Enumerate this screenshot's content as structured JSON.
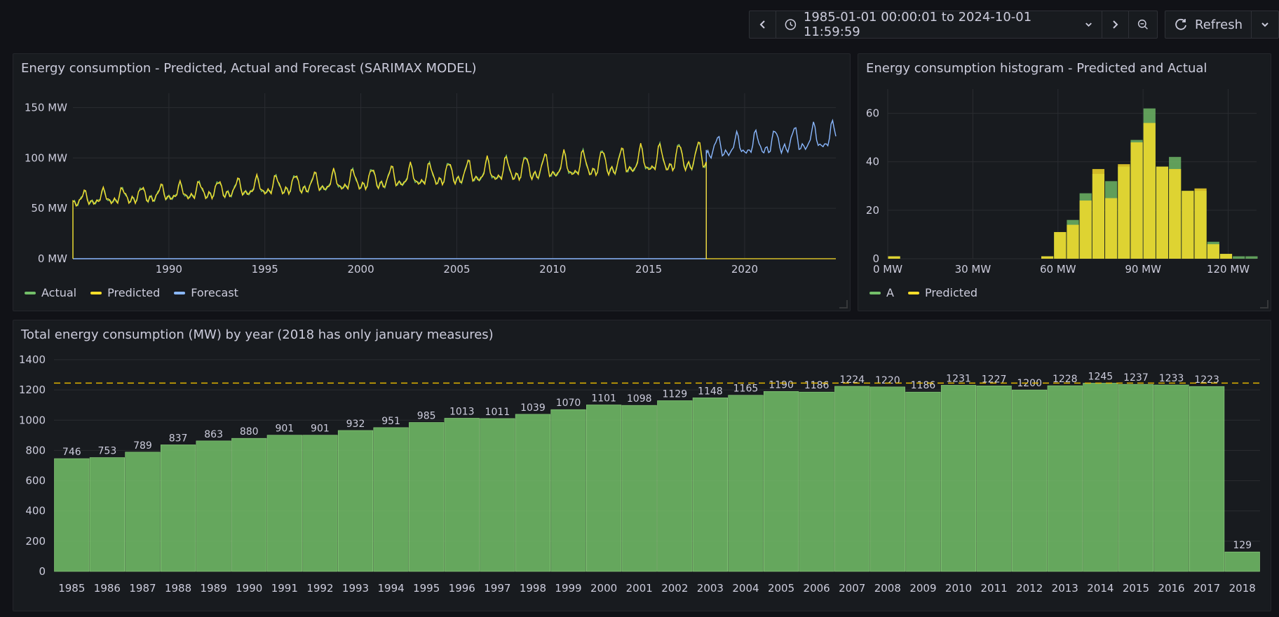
{
  "toolbar": {
    "time_range": "1985-01-01 00:00:01 to 2024-10-01 11:59:59",
    "refresh_label": "Refresh",
    "icons": [
      "chevron-left-icon",
      "clock-icon",
      "chevron-down-icon",
      "chevron-right-icon",
      "zoom-out-icon",
      "refresh-icon",
      "chevron-down-icon"
    ]
  },
  "colors": {
    "actual": "#73bf69",
    "predicted": "#fade2a",
    "forecast": "#8ab8ff",
    "threshold": "#e0b400"
  },
  "line_panel": {
    "title": "Energy consumption - Predicted, Actual and Forecast (SARIMAX MODEL)"
  },
  "hist_panel": {
    "title": "Energy consumption histogram - Predicted and Actual"
  },
  "bar_panel": {
    "title": "Total energy consumption (MW) by year (2018 has only january measures)"
  },
  "chart_data": [
    {
      "type": "line",
      "title": "Energy consumption - Predicted, Actual and Forecast (SARIMAX MODEL)",
      "x_ticks": [
        "1990",
        "1995",
        "2000",
        "2005",
        "2010",
        "2015",
        "2020"
      ],
      "y_ticks": [
        "0 MW",
        "50 MW",
        "100 MW",
        "150 MW"
      ],
      "xlim": [
        1985.0,
        2024.75
      ],
      "ylim": [
        0,
        160
      ],
      "legend": "bottom-left",
      "series": [
        {
          "name": "Actual",
          "start": 1985.0,
          "end": 2018.0,
          "base_start": 58,
          "base_end": 100,
          "amplitude_start": 8,
          "amplitude_end": 17
        },
        {
          "name": "Predicted",
          "start": 1985.0,
          "end": 2018.0,
          "base_start": 58,
          "base_end": 100,
          "amplitude_start": 8,
          "amplitude_end": 17
        },
        {
          "name": "Forecast",
          "start": 2018.0,
          "end": 2024.75,
          "base_start": 108,
          "base_end": 120,
          "amplitude_start": 12,
          "amplitude_end": 16
        }
      ]
    },
    {
      "type": "bar",
      "title": "Energy consumption histogram - Predicted and Actual",
      "x_ticks": [
        "0 MW",
        "30 MW",
        "60 MW",
        "90 MW",
        "120 MW"
      ],
      "y_ticks": [
        "0",
        "20",
        "40",
        "60"
      ],
      "xlim": [
        0,
        130
      ],
      "ylim": [
        0,
        70
      ],
      "bin_width": 4.5,
      "legend": "bottom-left",
      "series": [
        {
          "name": "A",
          "bins": [
            0,
            4.5,
            49.5,
            54,
            58.5,
            63,
            67.5,
            72,
            76.5,
            81,
            85.5,
            90,
            94.5,
            99,
            103.5,
            108,
            112.5,
            117,
            121.5,
            126
          ],
          "values": [
            1,
            0,
            0,
            1,
            11,
            16,
            27,
            35,
            32,
            38,
            49,
            62,
            38,
            42,
            28,
            28,
            7,
            2,
            1,
            1
          ]
        },
        {
          "name": "Predicted",
          "bins": [
            0,
            4.5,
            49.5,
            54,
            58.5,
            63,
            67.5,
            72,
            76.5,
            81,
            85.5,
            90,
            94.5,
            99,
            103.5,
            108,
            112.5,
            117,
            121.5,
            126
          ],
          "values": [
            1,
            0,
            0,
            1,
            11,
            14,
            24,
            37,
            25,
            39,
            48,
            56,
            38,
            37,
            28,
            29,
            6,
            2,
            0,
            0
          ]
        }
      ]
    },
    {
      "type": "bar",
      "title": "Total energy consumption (MW) by year (2018 has only january measures)",
      "categories": [
        "1985",
        "1986",
        "1987",
        "1988",
        "1989",
        "1990",
        "1991",
        "1992",
        "1993",
        "1994",
        "1995",
        "1996",
        "1997",
        "1998",
        "1999",
        "2000",
        "2001",
        "2002",
        "2003",
        "2004",
        "2005",
        "2006",
        "2007",
        "2008",
        "2009",
        "2010",
        "2011",
        "2012",
        "2013",
        "2014",
        "2015",
        "2016",
        "2017",
        "2018"
      ],
      "values": [
        746,
        753,
        789,
        837,
        863,
        880,
        901,
        901,
        932,
        951,
        985,
        1013,
        1011,
        1039,
        1070,
        1101,
        1098,
        1129,
        1148,
        1165,
        1190,
        1186,
        1224,
        1220,
        1186,
        1231,
        1227,
        1200,
        1228,
        1245,
        1237,
        1233,
        1223,
        129
      ],
      "y_ticks": [
        "0",
        "200",
        "400",
        "600",
        "800",
        "1000",
        "1200",
        "1400"
      ],
      "ylim": [
        0,
        1400
      ],
      "threshold": 1245
    }
  ]
}
